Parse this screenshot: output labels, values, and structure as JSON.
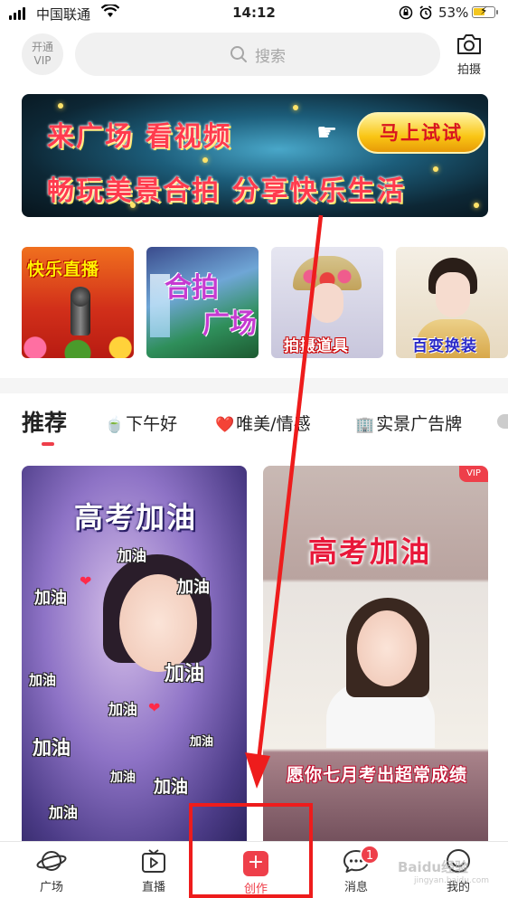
{
  "status_bar": {
    "carrier": "中国联通",
    "time": "14:12",
    "battery": "53%"
  },
  "header": {
    "vip_line1": "开通",
    "vip_line2": "VIP",
    "search_placeholder": "搜索",
    "camera_label": "拍摄"
  },
  "banner": {
    "line1": "来广场 看视频",
    "line2": "畅玩美景合拍 分享快乐生活",
    "cta": "马上试试"
  },
  "tiles": [
    {
      "label": "快乐直播"
    },
    {
      "label_a": "合拍",
      "label_b": "广场"
    },
    {
      "label": "拍摄道具"
    },
    {
      "label": "百变换装"
    }
  ],
  "tabs": {
    "active": "推荐",
    "items": [
      {
        "icon": "🍵",
        "label": "下午好"
      },
      {
        "icon": "❤️",
        "label": "唯美/情感"
      },
      {
        "icon": "🏢",
        "label": "实景广告牌"
      }
    ]
  },
  "cards": {
    "left": {
      "title": "高考加油",
      "cheers": [
        "加油",
        "加油",
        "加油",
        "加油",
        "加油",
        "加油",
        "加油",
        "加油",
        "加油",
        "加油",
        "加油"
      ]
    },
    "right": {
      "badge": "VIP",
      "title": "高考加油",
      "subtitle": "愿你七月考出超常成绩"
    }
  },
  "bottom_nav": {
    "items": [
      {
        "label": "广场",
        "icon": "planet-icon"
      },
      {
        "label": "直播",
        "icon": "tv-icon"
      },
      {
        "label": "创作",
        "icon": "plus-icon"
      },
      {
        "label": "消息",
        "icon": "chat-icon",
        "badge": "1"
      },
      {
        "label": "我的",
        "icon": "profile-icon"
      }
    ]
  },
  "watermark": {
    "brand": "Baidu经验",
    "url": "jingyan.baidu.com"
  },
  "colors": {
    "accent": "#ee3f4a",
    "annotation": "#ee1c1c"
  }
}
